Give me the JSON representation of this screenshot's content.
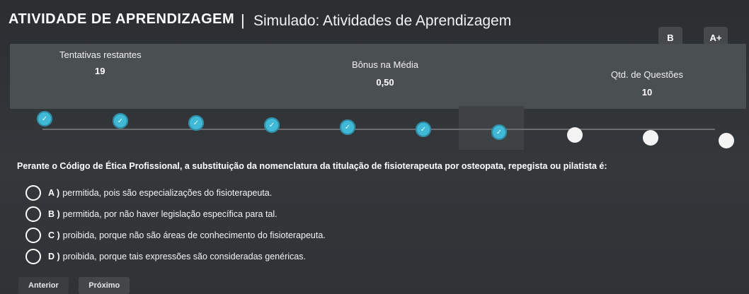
{
  "header": {
    "brand": "ATIVIDADE DE APRENDIZAGEM",
    "separator": "|",
    "title": "Simulado: Atividades de Aprendizagem",
    "font_btn": "B",
    "size_btn": "A+"
  },
  "stats": {
    "attempts_label": "Tentativas restantes",
    "attempts_value": "19",
    "bonus_label": "Bônus na Média",
    "bonus_value": "0,50",
    "questions_label": "Qtd. de Questões",
    "questions_value": "10"
  },
  "progress": {
    "total": 10,
    "answered": 7,
    "current_question": 7,
    "answered_color": "#3fb9d6",
    "pending_color": "#f4f4f4"
  },
  "question": {
    "text": "Perante o Código de Ética Profissional, a substituição da nomenclatura da titulação de fisioterapeuta por osteopata, repegista ou pilatista é:",
    "options": [
      {
        "letter": "A )",
        "text": "permitida, pois são especializações do fisioterapeuta."
      },
      {
        "letter": "B )",
        "text": "permitida, por não haver legislação específica para tal."
      },
      {
        "letter": "C )",
        "text": "proibida, porque não são áreas de conhecimento do fisioterapeuta."
      },
      {
        "letter": "D )",
        "text": "proibida, porque tais expressões são consideradas genéricas."
      }
    ]
  },
  "nav": {
    "prev_label": "Anterior",
    "next_label": "Próximo"
  }
}
